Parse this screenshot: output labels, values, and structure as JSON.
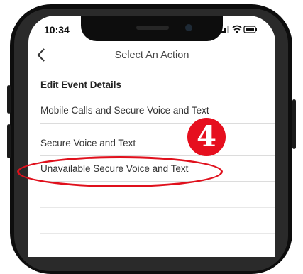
{
  "status_bar": {
    "time": "10:34",
    "icons": [
      "signal-icon",
      "wifi-icon",
      "battery-icon"
    ]
  },
  "nav": {
    "back_icon": "chevron-left-icon",
    "title": "Select An Action"
  },
  "list": {
    "items": [
      {
        "label": "Edit Event Details"
      },
      {
        "label": "Mobile Calls and Secure Voice and Text"
      },
      {
        "label": "Secure Voice and Text"
      },
      {
        "label": "Unavailable Secure Voice and Text"
      }
    ]
  },
  "annotation": {
    "step_number": "4",
    "color": "#e60f1e"
  }
}
